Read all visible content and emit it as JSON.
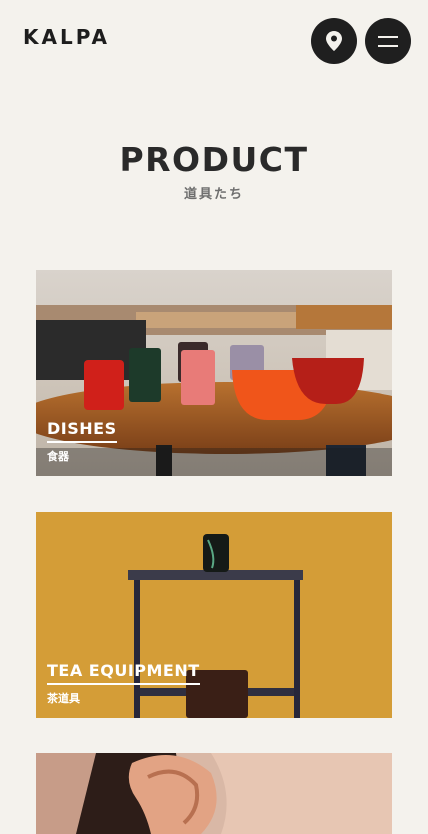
{
  "header": {
    "logo": "KALPA",
    "map_button_icon": "map-pin-icon",
    "menu_button_icon": "hamburger-menu-icon"
  },
  "page": {
    "title": "PRODUCT",
    "subtitle": "道具たち"
  },
  "products": [
    {
      "label_en": "DISHES",
      "label_ja": "食器"
    },
    {
      "label_en": "TEA EQUIPMENT",
      "label_ja": "茶道具"
    }
  ],
  "colors": {
    "background": "#f4f2ed",
    "text": "#1d1d1d",
    "button": "#1f1f1f",
    "tea_background": "#d9a23b"
  }
}
